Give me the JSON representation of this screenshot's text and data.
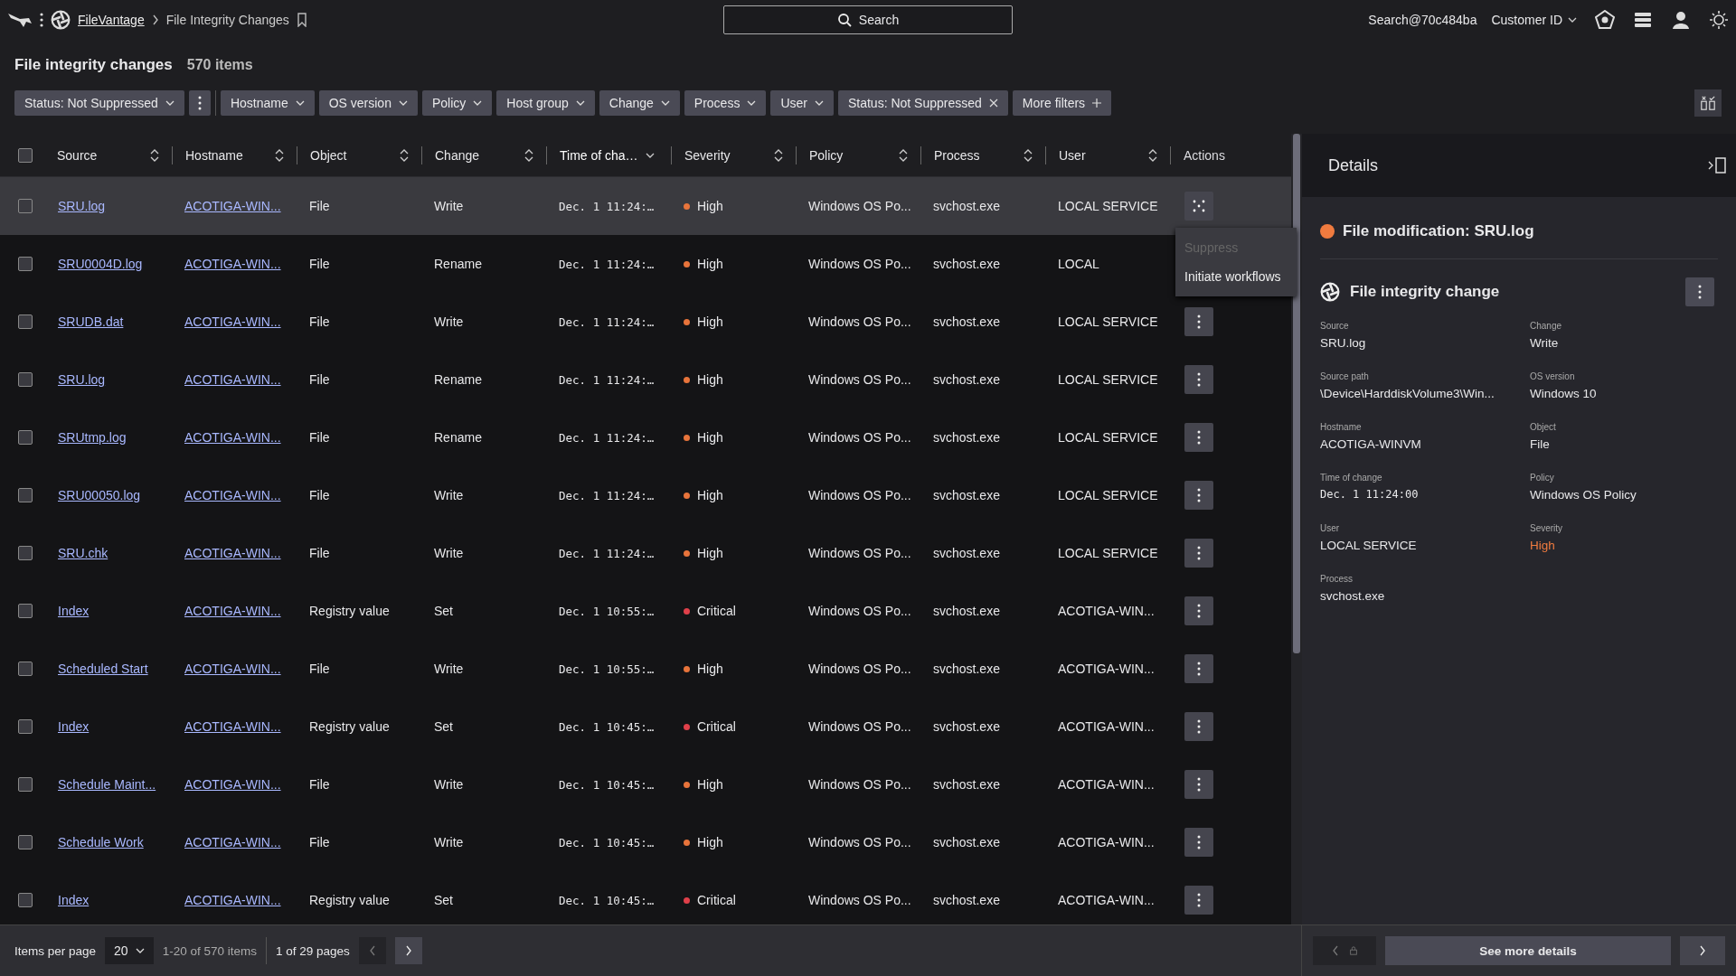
{
  "topbar": {
    "breadcrumb_link": "FileVantage",
    "breadcrumb_current": "File Integrity Changes",
    "search_label": "Search",
    "account": "Search@70c484ba",
    "customer": "Customer ID"
  },
  "header": {
    "title": "File integrity changes",
    "count": "570 items"
  },
  "filters": [
    {
      "kind": "dropdown",
      "label": "Status: Not Suppressed"
    },
    {
      "kind": "menu"
    },
    {
      "kind": "dropdown",
      "label": "Hostname"
    },
    {
      "kind": "dropdown",
      "label": "OS version"
    },
    {
      "kind": "dropdown",
      "label": "Policy"
    },
    {
      "kind": "dropdown",
      "label": "Host group"
    },
    {
      "kind": "dropdown",
      "label": "Change"
    },
    {
      "kind": "dropdown",
      "label": "Process"
    },
    {
      "kind": "dropdown",
      "label": "User"
    },
    {
      "kind": "removable",
      "label": "Status: Not Suppressed"
    },
    {
      "kind": "add",
      "label": "More filters"
    }
  ],
  "table": {
    "all_checked": false,
    "columns": [
      {
        "label": "Source",
        "sortable": true,
        "sorted": false
      },
      {
        "label": "Hostname",
        "sortable": true,
        "sorted": false
      },
      {
        "label": "Object",
        "sortable": true,
        "sorted": false
      },
      {
        "label": "Change",
        "sortable": true,
        "sorted": false
      },
      {
        "label": "Time of cha…",
        "sortable": true,
        "sorted": true
      },
      {
        "label": "Severity",
        "sortable": true,
        "sorted": false
      },
      {
        "label": "Policy",
        "sortable": true,
        "sorted": false
      },
      {
        "label": "Process",
        "sortable": true,
        "sorted": false
      },
      {
        "label": "User",
        "sortable": true,
        "sorted": false
      },
      {
        "label": "Actions",
        "sortable": false
      }
    ],
    "rows": [
      {
        "selected": true,
        "checked": false,
        "source": "SRU.log",
        "hostname": "ACOTIGA-WIN...",
        "object": "File",
        "change": "Write",
        "time": "Dec. 1 11:24:…",
        "severity": "High",
        "color": "#e8743b",
        "policy": "Windows OS Po...",
        "process": "svchost.exe",
        "user": "LOCAL SERVICE",
        "menu": [
          {
            "label": "Suppress",
            "disabled": true
          },
          {
            "label": "Initiate workflows",
            "disabled": false
          }
        ]
      },
      {
        "selected": false,
        "checked": false,
        "source": "SRU0004D.log",
        "hostname": "ACOTIGA-WIN...",
        "object": "File",
        "change": "Rename",
        "time": "Dec. 1 11:24:…",
        "severity": "High",
        "color": "#e8743b",
        "policy": "Windows OS Po...",
        "process": "svchost.exe",
        "user": "LOCAL"
      },
      {
        "selected": false,
        "checked": false,
        "source": "SRUDB.dat",
        "hostname": "ACOTIGA-WIN...",
        "object": "File",
        "change": "Write",
        "time": "Dec. 1 11:24:…",
        "severity": "High",
        "color": "#e8743b",
        "policy": "Windows OS Po...",
        "process": "svchost.exe",
        "user": "LOCAL SERVICE"
      },
      {
        "selected": false,
        "checked": false,
        "source": "SRU.log",
        "hostname": "ACOTIGA-WIN...",
        "object": "File",
        "change": "Rename",
        "time": "Dec. 1 11:24:…",
        "severity": "High",
        "color": "#e8743b",
        "policy": "Windows OS Po...",
        "process": "svchost.exe",
        "user": "LOCAL SERVICE"
      },
      {
        "selected": false,
        "checked": false,
        "source": "SRUtmp.log",
        "hostname": "ACOTIGA-WIN...",
        "object": "File",
        "change": "Rename",
        "time": "Dec. 1 11:24:…",
        "severity": "High",
        "color": "#e8743b",
        "policy": "Windows OS Po...",
        "process": "svchost.exe",
        "user": "LOCAL SERVICE"
      },
      {
        "selected": false,
        "checked": false,
        "source": "SRU00050.log",
        "hostname": "ACOTIGA-WIN...",
        "object": "File",
        "change": "Write",
        "time": "Dec. 1 11:24:…",
        "severity": "High",
        "color": "#e8743b",
        "policy": "Windows OS Po...",
        "process": "svchost.exe",
        "user": "LOCAL SERVICE"
      },
      {
        "selected": false,
        "checked": false,
        "source": "SRU.chk",
        "hostname": "ACOTIGA-WIN...",
        "object": "File",
        "change": "Write",
        "time": "Dec. 1 11:24:…",
        "severity": "High",
        "color": "#e8743b",
        "policy": "Windows OS Po...",
        "process": "svchost.exe",
        "user": "LOCAL SERVICE"
      },
      {
        "selected": false,
        "checked": false,
        "source": "Index",
        "hostname": "ACOTIGA-WIN...",
        "object": "Registry value",
        "change": "Set",
        "time": "Dec. 1 10:55:…",
        "severity": "Critical",
        "color": "#e0404a",
        "policy": "Windows OS Po...",
        "process": "svchost.exe",
        "user": "ACOTIGA-WIN..."
      },
      {
        "selected": false,
        "checked": false,
        "source": "Scheduled Start",
        "hostname": "ACOTIGA-WIN...",
        "object": "File",
        "change": "Write",
        "time": "Dec. 1 10:55:…",
        "severity": "High",
        "color": "#e8743b",
        "policy": "Windows OS Po...",
        "process": "svchost.exe",
        "user": "ACOTIGA-WIN..."
      },
      {
        "selected": false,
        "checked": false,
        "source": "Index",
        "hostname": "ACOTIGA-WIN...",
        "object": "Registry value",
        "change": "Set",
        "time": "Dec. 1 10:45:…",
        "severity": "Critical",
        "color": "#e0404a",
        "policy": "Windows OS Po...",
        "process": "svchost.exe",
        "user": "ACOTIGA-WIN..."
      },
      {
        "selected": false,
        "checked": false,
        "source": "Schedule Maint...",
        "hostname": "ACOTIGA-WIN...",
        "object": "File",
        "change": "Write",
        "time": "Dec. 1 10:45:…",
        "severity": "High",
        "color": "#e8743b",
        "policy": "Windows OS Po...",
        "process": "svchost.exe",
        "user": "ACOTIGA-WIN..."
      },
      {
        "selected": false,
        "checked": false,
        "source": "Schedule Work",
        "hostname": "ACOTIGA-WIN...",
        "object": "File",
        "change": "Write",
        "time": "Dec. 1 10:45:…",
        "severity": "High",
        "color": "#e8743b",
        "policy": "Windows OS Po...",
        "process": "svchost.exe",
        "user": "ACOTIGA-WIN..."
      },
      {
        "selected": false,
        "checked": false,
        "source": "Index",
        "hostname": "ACOTIGA-WIN...",
        "object": "Registry value",
        "change": "Set",
        "time": "Dec. 1 10:45:…",
        "severity": "Critical",
        "color": "#e0404a",
        "policy": "Windows OS Po...",
        "process": "svchost.exe",
        "user": "ACOTIGA-WIN..."
      }
    ]
  },
  "pagination": {
    "label": "Items per page",
    "per_page": "20",
    "range": "1-20 of 570 items",
    "pages": "1 of 29 pages"
  },
  "details": {
    "title": "Details",
    "event_title": "File modification: SRU.log",
    "section_title": "File integrity change",
    "fields": [
      {
        "label": "Source",
        "value": "SRU.log",
        "kind": "text"
      },
      {
        "label": "Change",
        "value": "Write",
        "kind": "text"
      },
      {
        "label": "Source path",
        "value": "\\Device\\HarddiskVolume3\\Win...",
        "kind": "text"
      },
      {
        "label": "OS version",
        "value": "Windows 10",
        "kind": "text"
      },
      {
        "label": "Hostname",
        "value": "ACOTIGA-WINVM",
        "kind": "text"
      },
      {
        "label": "Object",
        "value": "File",
        "kind": "text"
      },
      {
        "label": "Time of change",
        "value": "Dec. 1 11:24:00",
        "kind": "mono"
      },
      {
        "label": "Policy",
        "value": "Windows OS Policy",
        "kind": "text"
      },
      {
        "label": "User",
        "value": "LOCAL SERVICE",
        "kind": "text"
      },
      {
        "label": "Severity",
        "value": "High",
        "kind": "severity",
        "color": "#f07b3f"
      },
      {
        "label": "Process",
        "value": "svchost.exe",
        "kind": "text"
      }
    ],
    "see_more": "See more details"
  }
}
